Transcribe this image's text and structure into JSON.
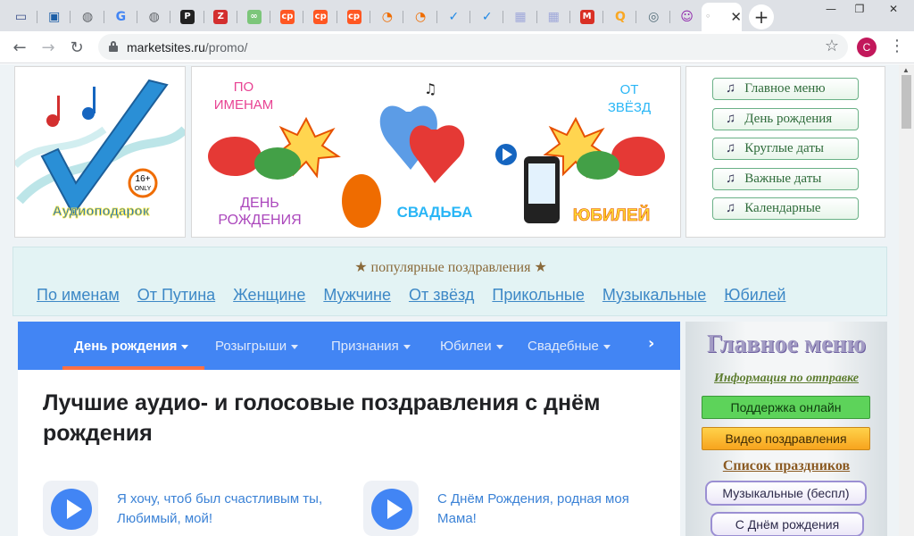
{
  "browser": {
    "tabs": [
      {
        "icon": "laptop-favicon",
        "color": "#3a4f8a"
      },
      {
        "icon": "monitor-favicon",
        "color": "#1d5fa7"
      },
      {
        "icon": "globe-favicon",
        "color": "#5f6368"
      },
      {
        "icon": "google-favicon",
        "color": "#4285f4"
      },
      {
        "icon": "globe-favicon",
        "color": "#5f6368"
      },
      {
        "icon": "p-favicon",
        "color": "#222222"
      },
      {
        "icon": "red-circle-favicon",
        "color": "#d32f2f"
      },
      {
        "icon": "link-favicon",
        "color": "#7cc67a"
      },
      {
        "icon": "cp-favicon",
        "color": "#ff5722"
      },
      {
        "icon": "cp-favicon",
        "color": "#ff5722"
      },
      {
        "icon": "cp-favicon",
        "color": "#ff5722"
      },
      {
        "icon": "pie-favicon",
        "color": "#ef6c00"
      },
      {
        "icon": "pie-favicon",
        "color": "#ef6c00"
      },
      {
        "icon": "check-favicon",
        "color": "#1e88e5"
      },
      {
        "icon": "check-favicon",
        "color": "#1e88e5"
      },
      {
        "icon": "pixel-favicon",
        "color": "#9fa8da"
      },
      {
        "icon": "pixel-favicon",
        "color": "#9fa8da"
      },
      {
        "icon": "gmail-favicon",
        "color": "#d93025"
      },
      {
        "icon": "q-favicon",
        "color": "#f9a825"
      },
      {
        "icon": "disc-favicon",
        "color": "#546e7a"
      },
      {
        "icon": "face-favicon",
        "color": "#8e24aa"
      }
    ],
    "active_tab_close": "✕",
    "new_tab": "+",
    "url_domain": "marketsites.ru",
    "url_path": "/promo/",
    "profile_initial": "C"
  },
  "header": {
    "logo_alt": "Аудиоподарок",
    "logo_badge": "16+ ONLY",
    "banner_words": [
      "ПО ИМЕНАМ",
      "ДЕНЬ РОЖДЕНИЯ",
      "СВАДЬБА",
      "ОТ ЗВЁЗД",
      "ЮБИЛЕЙ"
    ],
    "top_menu": [
      "Главное  меню",
      "День рождения",
      "Круглые даты",
      "Важные  даты",
      "Календарные"
    ],
    "note_glyph": "♫"
  },
  "popular": {
    "title": "★ популярные поздравления ★",
    "links": [
      "По именам",
      "От Путина",
      "Женщине",
      "Мужчине",
      "От звёзд",
      "Прикольные",
      "Музыкальные",
      "Юбилей"
    ]
  },
  "content": {
    "tabs": [
      "День рождения",
      "Розыгрыши",
      "Признания",
      "Юбилеи",
      "Свадебные"
    ],
    "next": "›",
    "heading": "Лучшие аудио- и голосовые поздравления с днём рождения",
    "cards": [
      {
        "text": "Я хочу, чтоб был счастливым ты, Любимый, мой!"
      },
      {
        "text": "С Днём Рождения, родная моя Мама!"
      }
    ]
  },
  "sidebar": {
    "title": "Главное меню",
    "info": "Информация по отправке",
    "support": "Поддержка онлайн",
    "video": "Видео поздравления",
    "holidays": "Список праздников",
    "musical": "Музыкальные (беспл)",
    "birthday": "С  Днём рождения"
  },
  "colors": {
    "accent_blue": "#4285f4",
    "tab_underline": "#ff7043",
    "link_blue": "#3d88c6"
  }
}
